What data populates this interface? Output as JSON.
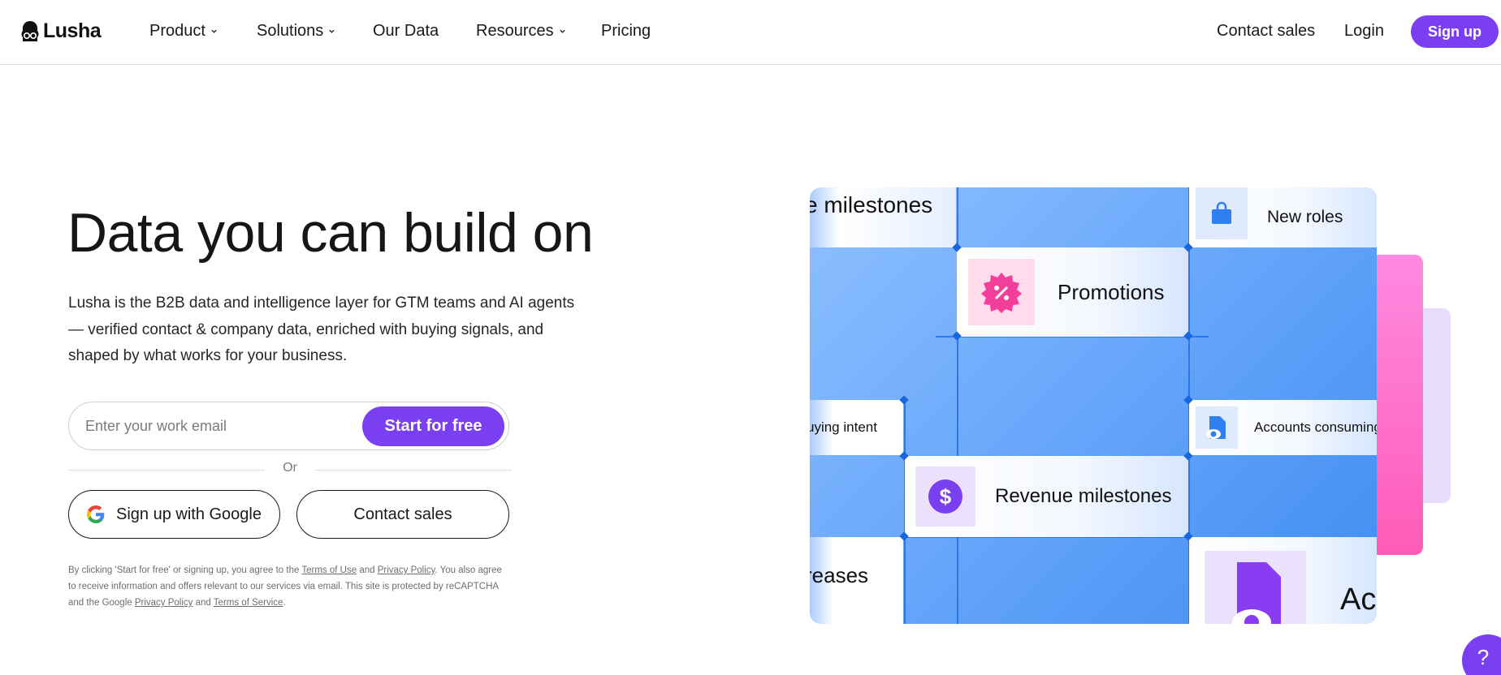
{
  "brand": {
    "name": "Lusha",
    "accent": "#7b3ff2"
  },
  "nav": {
    "items": [
      {
        "label": "Product",
        "dropdown": true
      },
      {
        "label": "Solutions",
        "dropdown": true
      },
      {
        "label": "Our Data",
        "dropdown": false
      },
      {
        "label": "Resources",
        "dropdown": true
      },
      {
        "label": "Pricing",
        "dropdown": false
      }
    ],
    "contact_sales": "Contact sales",
    "login": "Login",
    "signup": "Sign up"
  },
  "hero": {
    "title": "Data you can build on",
    "subtitle": "Lusha is the B2B data and intelligence layer for GTM teams and AI agents — verified contact & company data, enriched with buying signals, and shaped by what works for your business.",
    "email_placeholder": "Enter your work email",
    "start_button": "Start for free",
    "or_text": "Or",
    "google_button": "Sign up with Google",
    "contact_button": "Contact sales",
    "legal": {
      "p1": "By clicking 'Start for free' or signing up, you agree to the ",
      "terms_of_use": "Terms of Use",
      "and1": " and ",
      "privacy_policy": "Privacy Policy",
      "p2": ". You also agree to receive information and offers relevant to our services via email. This site is protected by reCAPTCHA and the Google ",
      "privacy_policy_2": "Privacy Policy",
      "and2": " and ",
      "terms_of_service": "Terms of Service",
      "p3": "."
    }
  },
  "illustration": {
    "cards": {
      "milestones_top": "e milestones",
      "new_roles": "New roles",
      "promotions": "Promotions",
      "buying_intent": "uying intent",
      "accounts_consuming": "Accounts consuming",
      "revenue_milestones": "Revenue milestones",
      "increases": "reases",
      "ac": "Ac"
    },
    "icons": {
      "new_roles": "shopping-bag-icon",
      "promotions": "percent-badge-icon",
      "accounts_consuming": "document-eye-icon",
      "revenue_milestones": "dollar-coin-icon"
    },
    "colors": {
      "blue": "#3f8cf2",
      "pink": "#ff5bb8",
      "lavender": "#e7dcfb",
      "purple": "#7b3ff2"
    }
  },
  "help": {
    "label": "?"
  }
}
